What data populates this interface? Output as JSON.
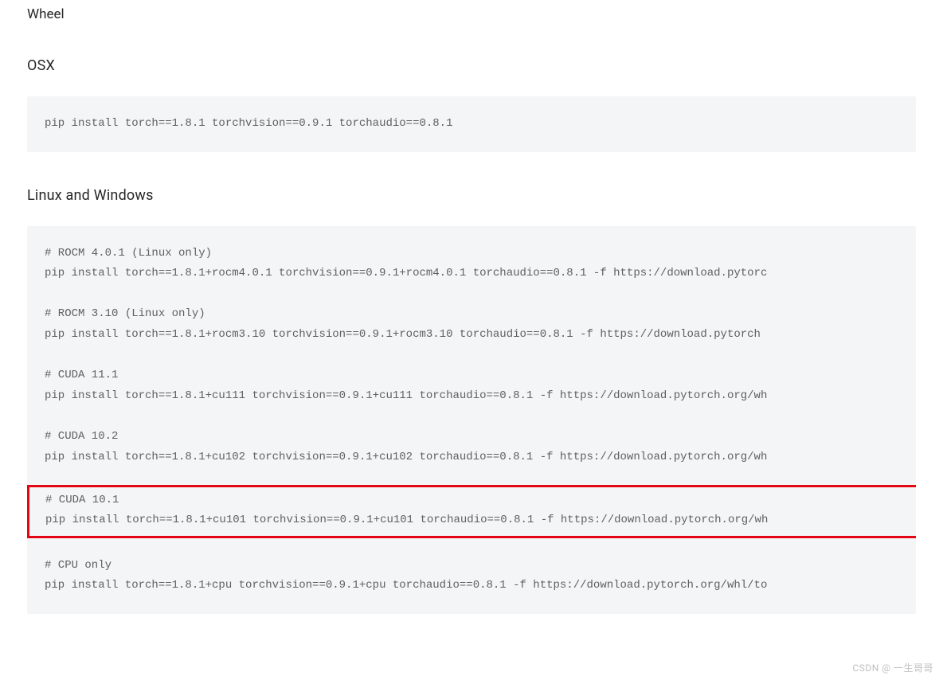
{
  "headings": {
    "wheel": "Wheel",
    "osx": "OSX",
    "linuxwin": "Linux and Windows"
  },
  "code": {
    "osx": "pip install torch==1.8.1 torchvision==0.9.1 torchaudio==0.8.1",
    "linuxwin_top": "# ROCM 4.0.1 (Linux only)\npip install torch==1.8.1+rocm4.0.1 torchvision==0.9.1+rocm4.0.1 torchaudio==0.8.1 -f https://download.pytorc\n\n# ROCM 3.10 (Linux only)\npip install torch==1.8.1+rocm3.10 torchvision==0.9.1+rocm3.10 torchaudio==0.8.1 -f https://download.pytorch\n\n# CUDA 11.1\npip install torch==1.8.1+cu111 torchvision==0.9.1+cu111 torchaudio==0.8.1 -f https://download.pytorch.org/wh\n\n# CUDA 10.2\npip install torch==1.8.1+cu102 torchvision==0.9.1+cu102 torchaudio==0.8.1 -f https://download.pytorch.org/wh\n",
    "linuxwin_highlight": "# CUDA 10.1\npip install torch==1.8.1+cu101 torchvision==0.9.1+cu101 torchaudio==0.8.1 -f https://download.pytorch.org/wh",
    "linuxwin_bottom": "\n# CPU only\npip install torch==1.8.1+cpu torchvision==0.9.1+cpu torchaudio==0.8.1 -f https://download.pytorch.org/whl/to"
  },
  "watermark": "CSDN @ 一生哥哥"
}
